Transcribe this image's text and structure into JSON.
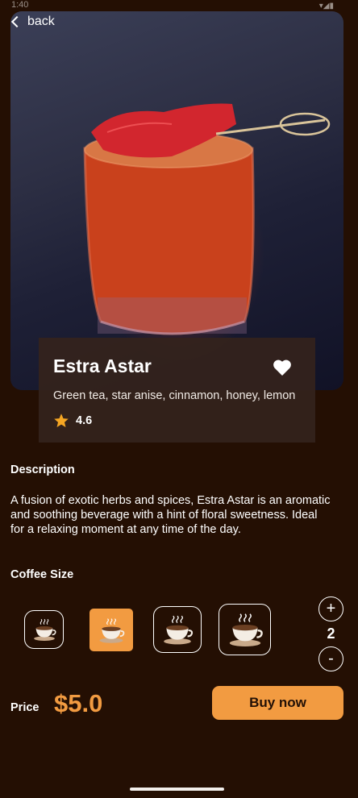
{
  "status": {
    "time": "1:40",
    "icons": "▾◢▮"
  },
  "nav": {
    "back_label": "back"
  },
  "product": {
    "name": "Estra Astar",
    "ingredients": "Green tea, star anise, cinnamon, honey, lemon",
    "rating": "4.6"
  },
  "description": {
    "title": "Description",
    "text": "A fusion of exotic herbs and spices, Estra Astar is an aromatic and soothing beverage with a hint of floral sweetness. Ideal for a relaxing moment at any time of the day."
  },
  "size": {
    "title": "Coffee Size",
    "options": [
      "small",
      "medium",
      "large",
      "extra-large"
    ],
    "selected": "medium"
  },
  "quantity": {
    "plus": "+",
    "minus": "-",
    "value": "2"
  },
  "checkout": {
    "price_label": "Price",
    "price": "$5.0",
    "buy_label": "Buy now"
  },
  "colors": {
    "accent": "#f29b41",
    "background": "#240f03",
    "card": "#34231c"
  }
}
